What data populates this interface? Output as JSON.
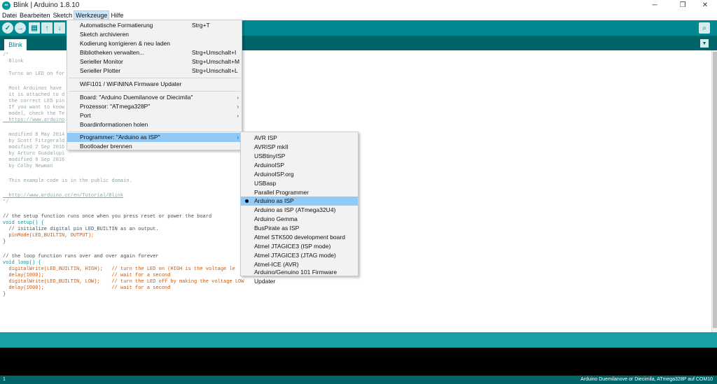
{
  "window": {
    "title": "Blink | Arduino 1.8.10",
    "icon_label": "∞",
    "controls": {
      "minimize": "─",
      "maximize": "❐",
      "close": "✕"
    }
  },
  "menubar": {
    "items": [
      "Datei",
      "Bearbeiten",
      "Sketch",
      "Werkzeuge",
      "Hilfe"
    ],
    "active": "Werkzeuge"
  },
  "toolbar": {
    "verify": "✓",
    "upload": "→",
    "new": "▤",
    "open": "↑",
    "save": "↓",
    "serial_monitor": "⌕"
  },
  "tabs": {
    "current": "Blink",
    "menu_icon": "▼"
  },
  "tools_menu": {
    "items": [
      {
        "label": "Automatische Formatierung",
        "shortcut": "Strg+T"
      },
      {
        "label": "Sketch archivieren",
        "shortcut": ""
      },
      {
        "label": "Kodierung korrigieren & neu laden",
        "shortcut": ""
      },
      {
        "label": "Bibliotheken verwalten...",
        "shortcut": "Strg+Umschalt+I"
      },
      {
        "label": "Serieller Monitor",
        "shortcut": "Strg+Umschalt+M"
      },
      {
        "label": "Serieller Plotter",
        "shortcut": "Strg+Umschalt+L"
      },
      {
        "label": "WiFi101 / WiFiNINA Firmware Updater",
        "shortcut": ""
      },
      {
        "label": "Board: \"Arduino Duemilanove or Diecimila\"",
        "shortcut": ""
      },
      {
        "label": "Prozessor: \"ATmega328P\"",
        "shortcut": ""
      },
      {
        "label": "Port",
        "shortcut": ""
      },
      {
        "label": "Boardinformationen holen",
        "shortcut": ""
      },
      {
        "label": "Programmer: \"Arduino as ISP\"",
        "shortcut": ""
      },
      {
        "label": "Bootloader brennen",
        "shortcut": ""
      }
    ],
    "submenu_arrow": "›"
  },
  "programmer_menu": {
    "items": [
      "AVR ISP",
      "AVRISP mkII",
      "USBtinyISP",
      "ArduinoISP",
      "ArduinoISP.org",
      "USBasp",
      "Parallel Programmer",
      "Arduino as ISP",
      "Arduino as ISP (ATmega32U4)",
      "Arduino Gemma",
      "BusPirate as ISP",
      "Atmel STK500 development board",
      "Atmel JTAGICE3 (ISP mode)",
      "Atmel JTAGICE3 (JTAG mode)",
      "Atmel-ICE (AVR)",
      "Arduino/Genuino 101 Firmware Updater"
    ],
    "selected": "Arduino as ISP"
  },
  "editor": {
    "lines": [
      "/*",
      "  Blink",
      "",
      "  Turns an LED on for",
      "",
      "  Most Arduinos have",
      "  it is attached to d",
      "  the correct LED pin",
      "  If you want to know",
      "  model, check the Te",
      "  https://www.arduino",
      "",
      "  modified 8 May 2014",
      "  by Scott Fitzgerald",
      "  modified 2 Sep 2016",
      "  by Arturo Guadalupi",
      "  modified 8 Sep 2016",
      "  by Colby Newman",
      "",
      "  This example code is in the public domain.",
      "",
      "  http://www.arduino.cc/en/Tutorial/Blink",
      "*/",
      "",
      "// the setup function runs once when you press reset or power the board",
      "void setup() {",
      "  // initialize digital pin LED_BUILTIN as an output.",
      "  pinMode(LED_BUILTIN, OUTPUT);",
      "}",
      "",
      "// the loop function runs over and over again forever",
      "void loop() {",
      "  digitalWrite(LED_BUILTIN, HIGH);   // turn the LED on (HIGH is the voltage le",
      "  delay(1000);                       // wait for a second",
      "  digitalWrite(LED_BUILTIN, LOW);    // turn the LED off by making the voltage LOW",
      "  delay(1000);                       // wait for a second",
      "}"
    ]
  },
  "status": {
    "line": "1",
    "board": "Arduino Duemilanove or Diecimila, ATmega328P auf COM10"
  },
  "colors": {
    "teal_dark": "#006468",
    "teal": "#00878f",
    "teal_light": "#17a1a5",
    "menu_highlight": "#91c9f7"
  }
}
